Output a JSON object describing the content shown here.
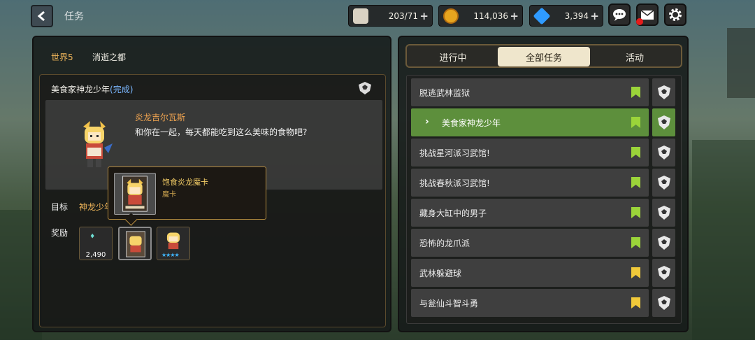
{
  "header": {
    "title": "任务",
    "resources": {
      "coffee": {
        "value": "203/71",
        "plus": "+"
      },
      "coins": {
        "value": "114,036",
        "plus": "+"
      },
      "gems": {
        "value": "3,394",
        "plus": "+"
      }
    }
  },
  "quest_detail": {
    "world": "世界5",
    "area": "消逝之都",
    "title": "美食家神龙少年",
    "status": "(完成)",
    "speaker": "炎龙吉尔瓦斯",
    "dialogue": "和你在一起，每天都能吃到这么美味的食物吧?",
    "target_label": "目标",
    "target_text": "神龙少年",
    "reward_label": "奖励",
    "rewards": [
      {
        "name": "gems",
        "count": "2,490"
      },
      {
        "name": "card",
        "count": ""
      },
      {
        "name": "pet",
        "stars": "★★★★"
      }
    ],
    "tooltip": {
      "name": "饱食炎龙魔卡",
      "type": "魔卡"
    }
  },
  "tabs": [
    "进行中",
    "全部任务",
    "活动"
  ],
  "active_tab": "全部任务",
  "quests": [
    {
      "name": "脱逃武林监狱",
      "flag_color": "#9bd43a",
      "active": false
    },
    {
      "name": "美食家神龙少年",
      "flag_color": "#9bd43a",
      "active": true
    },
    {
      "name": "挑战星河派习武馆!",
      "flag_color": "#9bd43a",
      "active": false
    },
    {
      "name": "挑战春秋派习武馆!",
      "flag_color": "#9bd43a",
      "active": false
    },
    {
      "name": "藏身大缸中的男子",
      "flag_color": "#9bd43a",
      "active": false
    },
    {
      "name": "恐怖的龙爪派",
      "flag_color": "#9bd43a",
      "active": false
    },
    {
      "name": "武林躲避球",
      "flag_color": "#f0c93a",
      "active": false
    },
    {
      "name": "与瓮仙斗智斗勇",
      "flag_color": "#f0c93a",
      "active": false
    }
  ]
}
